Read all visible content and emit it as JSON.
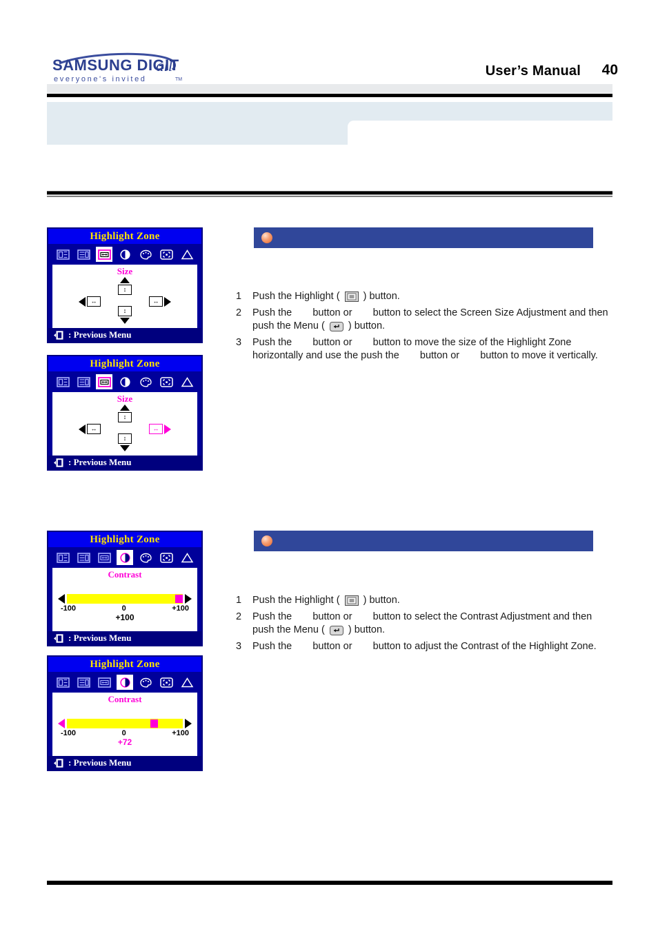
{
  "header": {
    "brand_line1": "SAMSUNG DIGITall",
    "brand_line2": "everyone's invited",
    "brand_tm": "TM",
    "title": "User’s Manual",
    "page_number": "40"
  },
  "sections": [
    {
      "id": "screen-size-adjustment",
      "bar_label": "",
      "steps": [
        {
          "num": "1",
          "pre": "Push the Highlight (",
          "icon": "highlight-button-icon",
          "post": ") button."
        },
        {
          "num": "2",
          "pre": "Push the",
          "mid": "button or",
          "post": "button to select the Screen Size Adjustment and then push the Menu (",
          "icon": "menu-button-icon",
          "tail": ") button."
        },
        {
          "num": "3",
          "pre": "Push the",
          "mid": "button or",
          "post": "button to move the size of the Highlight Zone horizontally and use the push the",
          "mid2": "button or",
          "tail": "button to move it vertically."
        }
      ]
    },
    {
      "id": "contrast-adjustment",
      "bar_label": "",
      "steps": [
        {
          "num": "1",
          "pre": "Push the Highlight (",
          "icon": "highlight-button-icon",
          "post": ") button."
        },
        {
          "num": "2",
          "pre": "Push the",
          "mid": "button or",
          "post": "button to select the Contrast Adjustment and then push the Menu (",
          "icon": "menu-button-icon",
          "tail": ") button."
        },
        {
          "num": "3",
          "pre": "Push the",
          "mid": "button or",
          "post": "button to adjust the Contrast of the Highlight Zone.",
          "mid2": "",
          "tail": ""
        }
      ]
    }
  ],
  "osd_panels": [
    {
      "id": "osd-size-1",
      "title": "Highlight Zone",
      "submenu": "Size",
      "selected_icon_index": 2,
      "footer": ": Previous Menu",
      "mode": "cross",
      "highlighted_direction": "none"
    },
    {
      "id": "osd-size-2",
      "title": "Highlight Zone",
      "submenu": "Size",
      "selected_icon_index": 2,
      "footer": ": Previous Menu",
      "mode": "cross",
      "highlighted_direction": "right"
    },
    {
      "id": "osd-contrast-1",
      "title": "Highlight Zone",
      "submenu": "Contrast",
      "selected_icon_index": 3,
      "footer": ": Previous Menu",
      "mode": "slider",
      "slider": {
        "min_label": "-100",
        "mid_label": "0",
        "max_label": "+100",
        "value_label": "+100",
        "value_color": "black",
        "percent": 96,
        "left_arrow_color": "black",
        "right_arrow_color": "black"
      }
    },
    {
      "id": "osd-contrast-2",
      "title": "Highlight Zone",
      "submenu": "Contrast",
      "selected_icon_index": 3,
      "footer": ": Previous Menu",
      "mode": "slider",
      "slider": {
        "min_label": "-100",
        "mid_label": "0",
        "max_label": "+100",
        "value_label": "+72",
        "value_color": "pink",
        "percent": 74,
        "left_arrow_color": "pink",
        "right_arrow_color": "black"
      }
    }
  ],
  "osd_icon_names": [
    "screen-position-icon",
    "screen-size-icon",
    "highlight-size-icon",
    "contrast-icon",
    "color-palette-icon",
    "zone-frame-icon",
    "warning-triangle-icon"
  ],
  "colors": {
    "osd_background": "#00009a",
    "osd_title_bar": "#0000f0",
    "osd_title_text": "#ffe400",
    "accent_pink": "#ff00d8",
    "slider_track": "#ffff00",
    "section_bar": "#30479a",
    "banner": "#e2ebf1"
  }
}
